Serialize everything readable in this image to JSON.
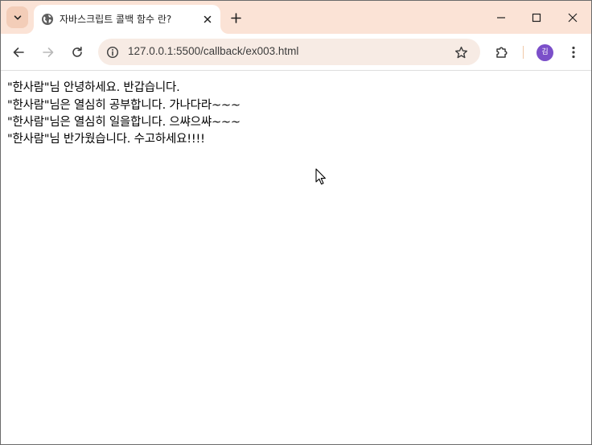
{
  "browser": {
    "tab": {
      "title": "자바스크립트 콜백 함수 란?",
      "favicon": "globe-icon"
    },
    "address_bar": {
      "url": "127.0.0.1:5500/callback/ex003.html"
    },
    "profile": {
      "initial": "김",
      "color": "#7b4fc9"
    },
    "colors": {
      "titlebar": "#fbe3d6",
      "omnibox": "#f7ebe4"
    }
  },
  "page": {
    "lines": [
      "\"한사람\"님 안녕하세요. 반갑습니다.",
      "\"한사람\"님은 열심히 공부합니다. 가나다라~~~",
      "\"한사람\"님은 열심히 일을합니다. 으쌰으쌰~~~",
      "\"한사람\"님 반가웠습니다. 수고하세요!!!!"
    ]
  }
}
